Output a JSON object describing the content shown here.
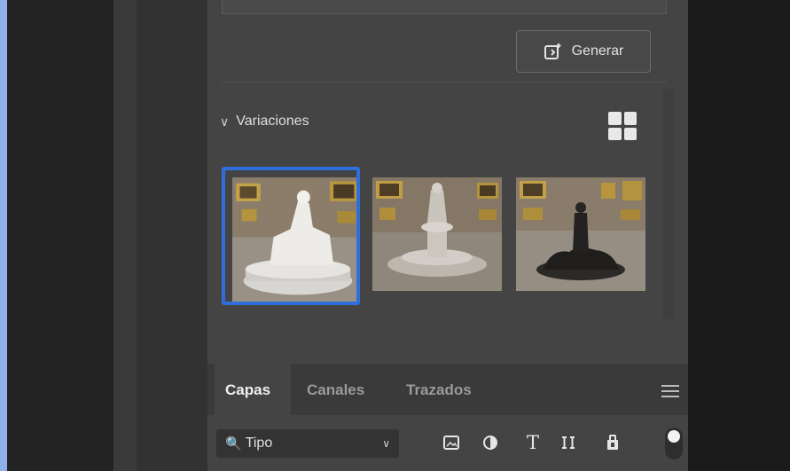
{
  "generate": {
    "label": "Generar",
    "icon": "generate-icon"
  },
  "variations": {
    "heading": "Variaciones",
    "collapse_icon": "chevron-down-icon",
    "view_icon": "grid-view-icon",
    "selected_index": 0,
    "thumbnails": [
      {
        "name": "variation-1",
        "subject": "white seated statue"
      },
      {
        "name": "variation-2",
        "subject": "fountain sculpture"
      },
      {
        "name": "variation-3",
        "subject": "dark statue"
      }
    ]
  },
  "tabs": [
    {
      "label": "Capas",
      "active": true
    },
    {
      "label": "Canales",
      "active": false
    },
    {
      "label": "Trazados",
      "active": false
    }
  ],
  "filter": {
    "value": "Tipo",
    "icons": [
      "image-filter-icon",
      "adjustment-filter-icon",
      "type-filter-icon",
      "shape-filter-icon",
      "smart-object-filter-icon"
    ]
  },
  "colors": {
    "accent": "#2f6fdc",
    "panel": "#444444",
    "tabs_bar": "#3a3a3a"
  }
}
